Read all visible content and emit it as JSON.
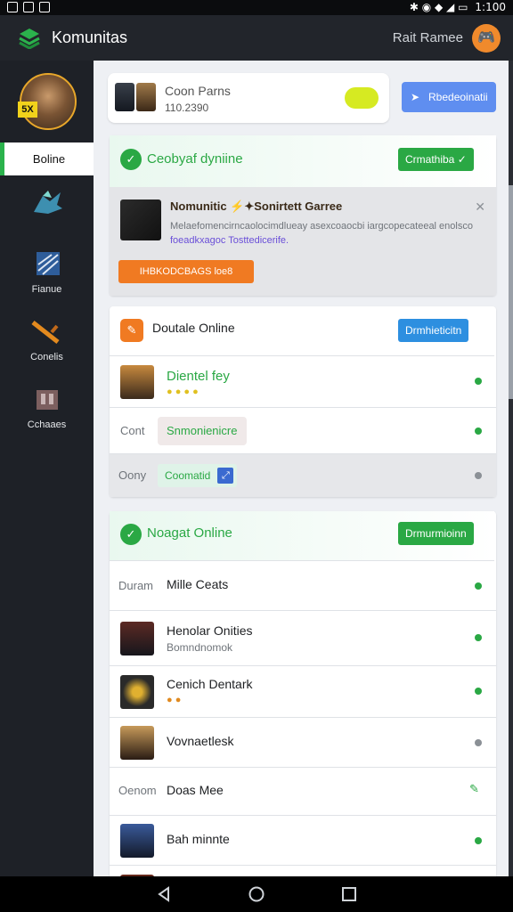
{
  "statusbar": {
    "time": "1:100"
  },
  "appbar": {
    "title": "Komunitas",
    "right_label": "Rait Ramee",
    "avatar_icon": "gamepad-icon"
  },
  "sidebar": {
    "profile_badge": "5X",
    "selected_label": "Boline",
    "items": [
      {
        "label": "",
        "icon": "dragon-icon"
      },
      {
        "label": "Fianue",
        "icon": "flag-icon"
      },
      {
        "label": "Conelis",
        "icon": "sword-icon"
      },
      {
        "label": "Cchaaes",
        "icon": "castle-icon"
      }
    ]
  },
  "top_card": {
    "title": "Coon Parns",
    "subtitle": "110.2390"
  },
  "top_button": {
    "label": "Rbedeoinatii"
  },
  "section1": {
    "title": "Ceobyaf dyniine",
    "button": "Crmathiba ✓",
    "promo": {
      "title": "Nomunitic ⚡✦Sonirtett Garree",
      "body_line1": "Melaefomencirncaolocimdlueay asexcoaocbi iargcopecateeal enolsco",
      "body_line2": "foeadkxagoc Tosttedicerife.",
      "cta": "IHBKODCBAGS   loe8"
    }
  },
  "section2": {
    "title": "Doutale Online",
    "button": "Drmhieticitn",
    "rows": [
      {
        "name": "Dientel fey",
        "sub": ""
      },
      {
        "prefix": "Cont",
        "chip": "Snmonienicre"
      },
      {
        "prefix": "Oony",
        "chip": "Coomatid"
      }
    ]
  },
  "section3": {
    "title": "Noagat Online",
    "button": "Drmurmioinn",
    "rows": [
      {
        "prefix": "Duram",
        "name": "Mille Ceats",
        "sub": ""
      },
      {
        "name": "Henolar Onities",
        "sub": "Bomndnomok"
      },
      {
        "name": "Cenich Dentark",
        "sub": ""
      },
      {
        "name": "Vovnaetlesk",
        "sub": ""
      },
      {
        "prefix": "Oenom",
        "name": "Doas Mee",
        "sub": ""
      },
      {
        "name": "Bah minnte",
        "sub": ""
      }
    ]
  },
  "colors": {
    "green": "#2aa844",
    "blue": "#2d8fe0",
    "orange": "#f07a22"
  }
}
